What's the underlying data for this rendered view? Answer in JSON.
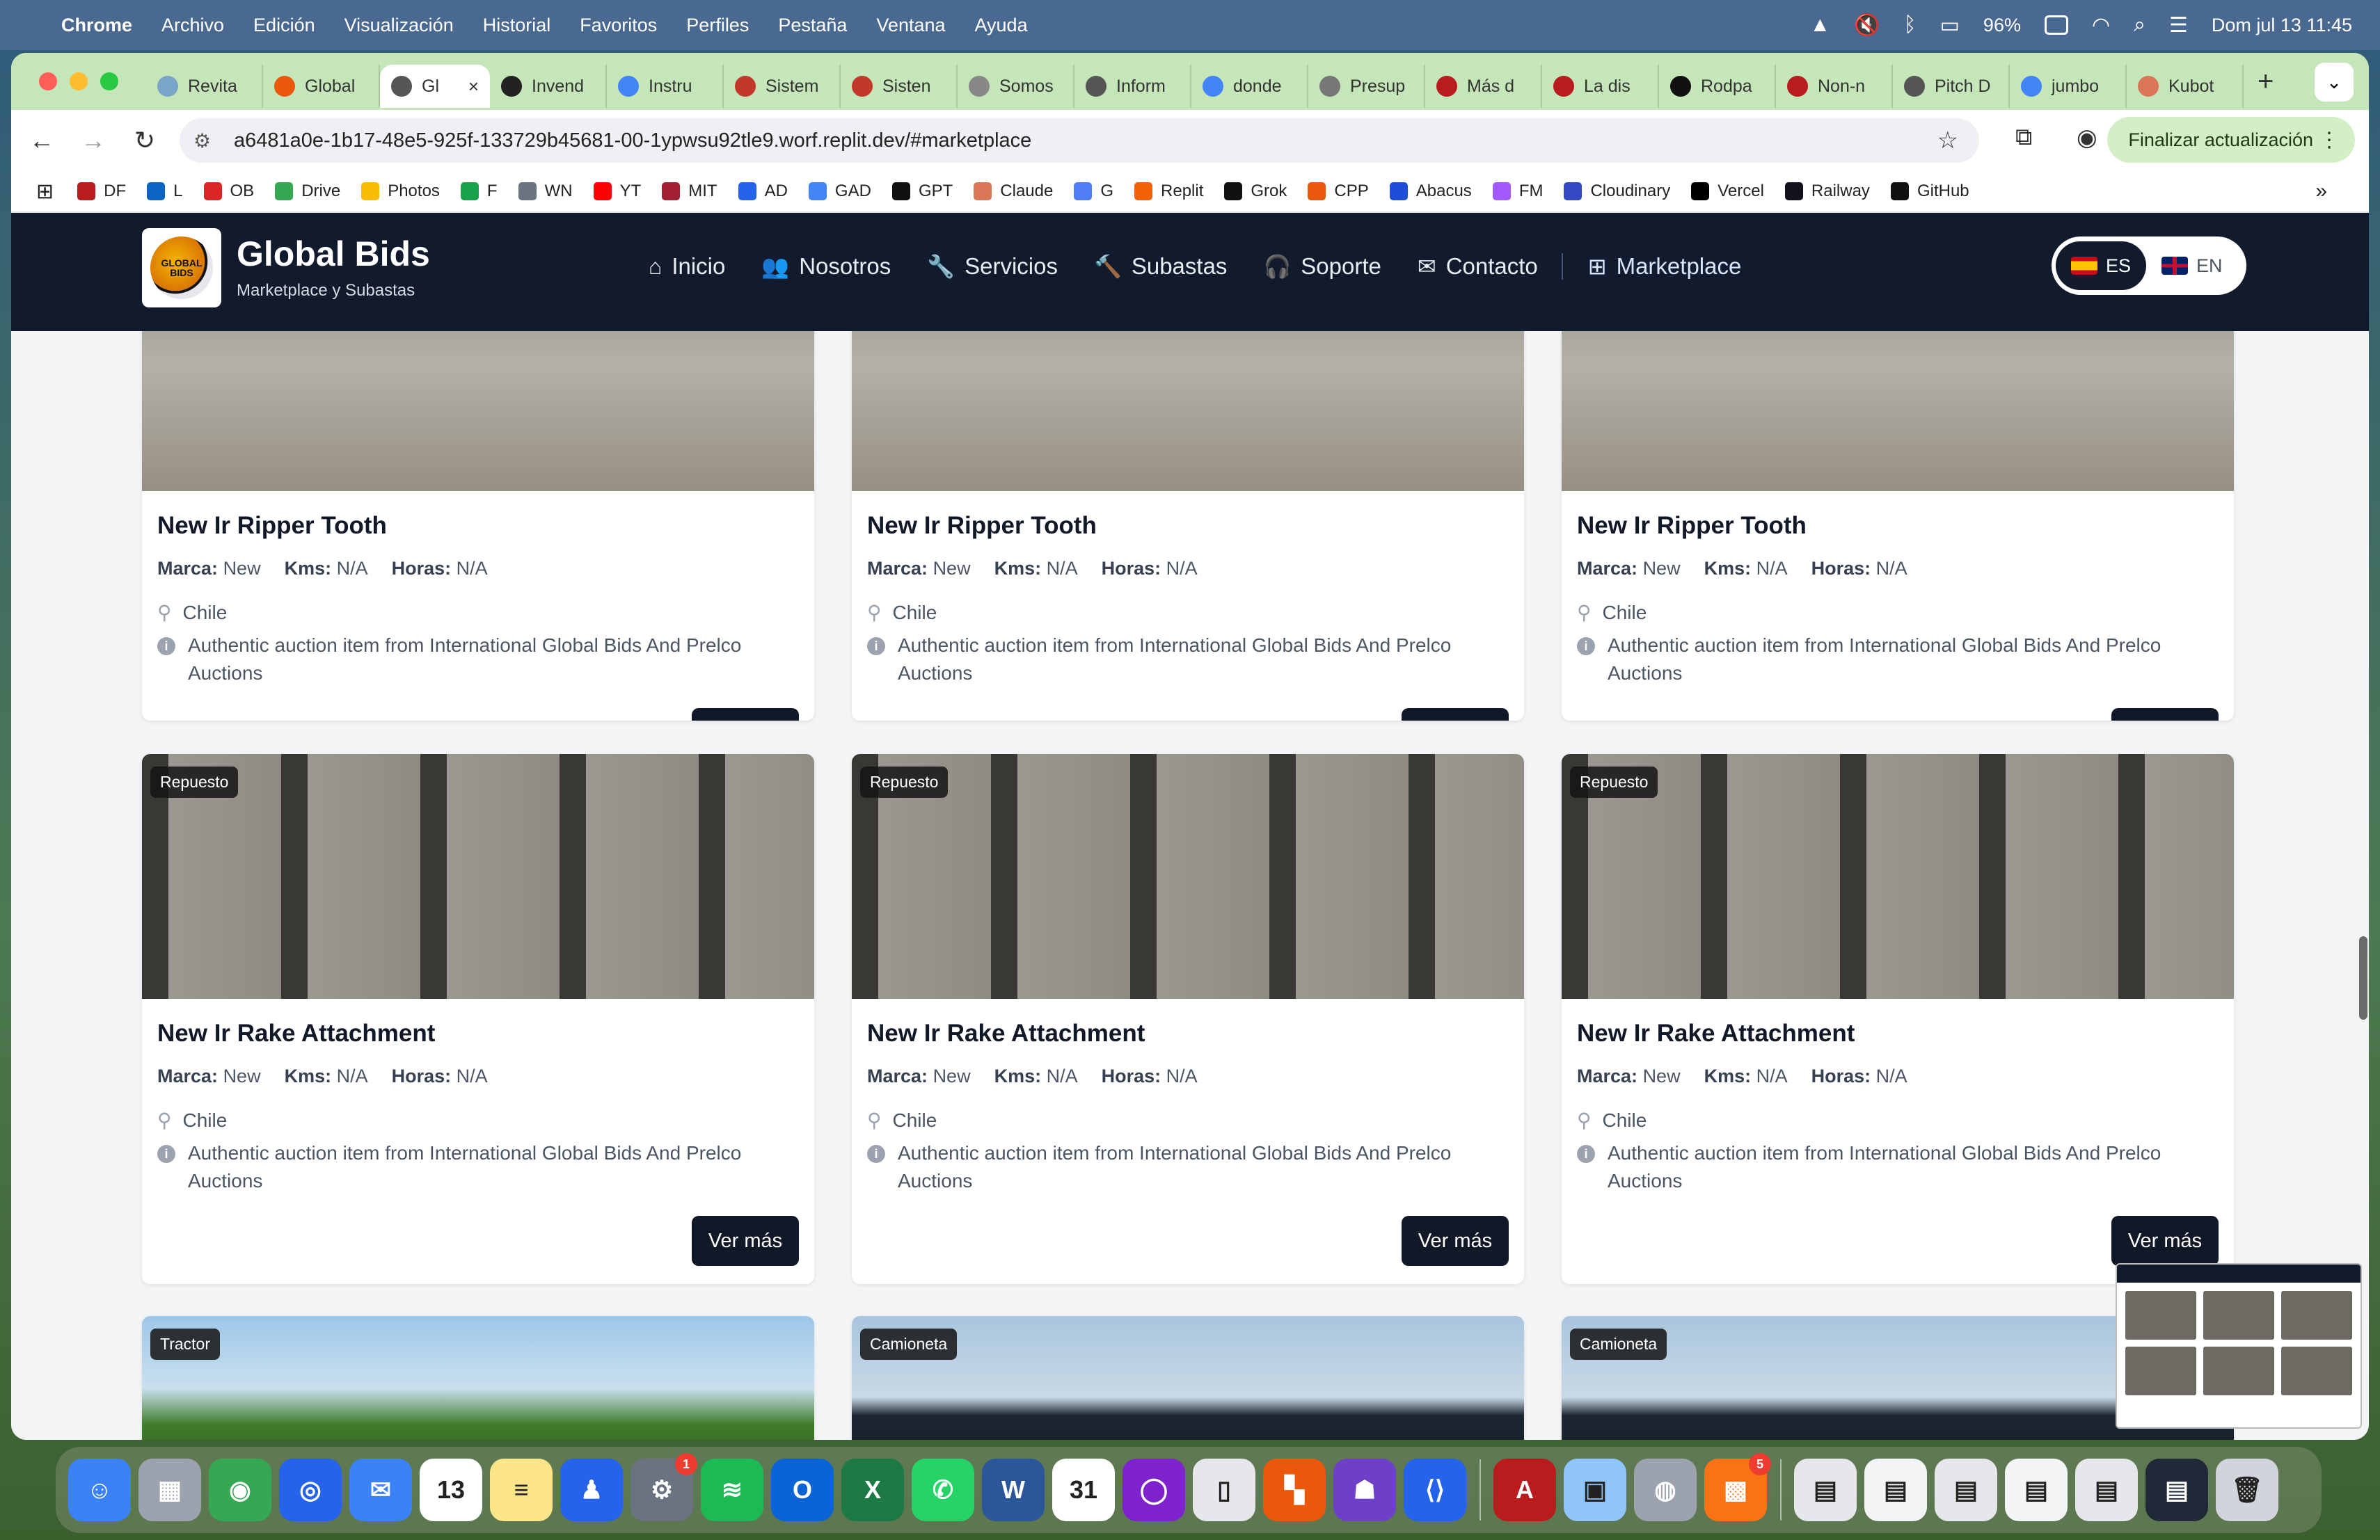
{
  "menubar": {
    "app": "Chrome",
    "items": [
      "Archivo",
      "Edición",
      "Visualización",
      "Historial",
      "Favoritos",
      "Perfiles",
      "Pestaña",
      "Ventana",
      "Ayuda"
    ],
    "battery": "96%",
    "datetime": "Dom jul 13  11:45"
  },
  "tabs": [
    {
      "label": "Revita",
      "color": "#7aa5c9"
    },
    {
      "label": "Global",
      "color": "#ea580c"
    },
    {
      "label": "Gl",
      "color": "#555555",
      "active": true
    },
    {
      "label": "Invend",
      "color": "#222222"
    },
    {
      "label": "Instru",
      "color": "#4285f4"
    },
    {
      "label": "Sistem",
      "color": "#c0392b"
    },
    {
      "label": "Sisten",
      "color": "#c0392b"
    },
    {
      "label": "Somos",
      "color": "#888888"
    },
    {
      "label": "Inform",
      "color": "#555555"
    },
    {
      "label": "donde",
      "color": "#4285f4"
    },
    {
      "label": "Presup",
      "color": "#777777"
    },
    {
      "label": "Más d",
      "color": "#b91c1c"
    },
    {
      "label": "La dis",
      "color": "#b91c1c"
    },
    {
      "label": "Rodpa",
      "color": "#111111"
    },
    {
      "label": "Non-n",
      "color": "#b91c1c"
    },
    {
      "label": "Pitch D",
      "color": "#555555"
    },
    {
      "label": "jumbo",
      "color": "#4285f4"
    },
    {
      "label": "Kubot",
      "color": "#d97757"
    }
  ],
  "address": {
    "url": "a6481a0e-1b17-48e5-925f-133729b45681-00-1ypwsu92tle9.worf.replit.dev/#marketplace",
    "update_label": "Finalizar actualización"
  },
  "bookmarks": [
    {
      "label": "DF",
      "color": "#b91c1c"
    },
    {
      "label": "L",
      "color": "#0a66c2"
    },
    {
      "label": "OB",
      "color": "#dc2626"
    },
    {
      "label": "Drive",
      "color": "#34a853"
    },
    {
      "label": "Photos",
      "color": "#fbbc04"
    },
    {
      "label": "F",
      "color": "#16a34a"
    },
    {
      "label": "WN",
      "color": "#6b7280"
    },
    {
      "label": "YT",
      "color": "#ff0000"
    },
    {
      "label": "MIT",
      "color": "#a31f34"
    },
    {
      "label": "AD",
      "color": "#2563eb"
    },
    {
      "label": "GAD",
      "color": "#4285f4"
    },
    {
      "label": "GPT",
      "color": "#111111"
    },
    {
      "label": "Claude",
      "color": "#d97757"
    },
    {
      "label": "G",
      "color": "#4f7df3"
    },
    {
      "label": "Replit",
      "color": "#f26207"
    },
    {
      "label": "Grok",
      "color": "#111111"
    },
    {
      "label": "CPP",
      "color": "#ea580c"
    },
    {
      "label": "Abacus",
      "color": "#1d4ed8"
    },
    {
      "label": "FM",
      "color": "#a259ff"
    },
    {
      "label": "Cloudinary",
      "color": "#3448c5"
    },
    {
      "label": "Vercel",
      "color": "#000000"
    },
    {
      "label": "Railway",
      "color": "#13111c"
    },
    {
      "label": "GitHub",
      "color": "#111111"
    }
  ],
  "site": {
    "brand_title": "Global Bids",
    "brand_sub": "Marketplace y Subastas",
    "logo_text": "GLOBAL BIDS",
    "nav": [
      {
        "label": "Inicio",
        "icon": "home-icon",
        "glyph": "⌂"
      },
      {
        "label": "Nosotros",
        "icon": "users-icon",
        "glyph": "👥"
      },
      {
        "label": "Servicios",
        "icon": "wrench-icon",
        "glyph": "🔧"
      },
      {
        "label": "Subastas",
        "icon": "gavel-icon",
        "glyph": "🔨"
      },
      {
        "label": "Soporte",
        "icon": "headset-icon",
        "glyph": "🎧"
      },
      {
        "label": "Contacto",
        "icon": "envelope-icon",
        "glyph": "✉"
      },
      {
        "label": "Marketplace",
        "icon": "grid-icon",
        "glyph": "⊞"
      }
    ],
    "lang_es": "ES",
    "lang_en": "EN"
  },
  "labels": {
    "marca": "Marca:",
    "kms": "Kms:",
    "horas": "Horas:",
    "ver_mas": "Ver más"
  },
  "cards_row1": [
    {
      "title": "New Ir Ripper Tooth",
      "marca": "New",
      "kms": "N/A",
      "horas": "N/A",
      "location": "Chile",
      "description": "Authentic auction item from International Global Bids And Prelco Auctions"
    },
    {
      "title": "New Ir Ripper Tooth",
      "marca": "New",
      "kms": "N/A",
      "horas": "N/A",
      "location": "Chile",
      "description": "Authentic auction item from International Global Bids And Prelco Auctions"
    },
    {
      "title": "New Ir Ripper Tooth",
      "marca": "New",
      "kms": "N/A",
      "horas": "N/A",
      "location": "Chile",
      "description": "Authentic auction item from International Global Bids And Prelco Auctions"
    }
  ],
  "cards_row2": [
    {
      "category": "Repuesto",
      "title": "New Ir Rake Attachment",
      "marca": "New",
      "kms": "N/A",
      "horas": "N/A",
      "location": "Chile",
      "description": "Authentic auction item from International Global Bids And Prelco Auctions"
    },
    {
      "category": "Repuesto",
      "title": "New Ir Rake Attachment",
      "marca": "New",
      "kms": "N/A",
      "horas": "N/A",
      "location": "Chile",
      "description": "Authentic auction item from International Global Bids And Prelco Auctions"
    },
    {
      "category": "Repuesto",
      "title": "New Ir Rake Attachment",
      "marca": "New",
      "kms": "N/A",
      "horas": "N/A",
      "location": "Chile",
      "description": "Authentic auction item from International Global Bids And Prelco Auctions"
    }
  ],
  "cards_row3": [
    {
      "category": "Tractor"
    },
    {
      "category": "Camioneta"
    },
    {
      "category": "Camioneta"
    }
  ],
  "dock": [
    {
      "name": "finder-icon",
      "color": "#3b82f6",
      "glyph": "☺"
    },
    {
      "name": "launchpad-icon",
      "color": "#9ca3af",
      "glyph": "▦"
    },
    {
      "name": "chrome-icon",
      "color": "#34a853",
      "glyph": "◉"
    },
    {
      "name": "safari-icon",
      "color": "#2563eb",
      "glyph": "◎"
    },
    {
      "name": "mail-icon",
      "color": "#3b82f6",
      "glyph": "✉"
    },
    {
      "name": "calendar-icon",
      "color": "#ffffff",
      "glyph": "13"
    },
    {
      "name": "notes-icon",
      "color": "#fde68a",
      "glyph": "≡"
    },
    {
      "name": "keynote-icon",
      "color": "#2563eb",
      "glyph": "♟"
    },
    {
      "name": "system-settings-icon",
      "color": "#6b7280",
      "glyph": "⚙",
      "badge": "1"
    },
    {
      "name": "spotify-icon",
      "color": "#1db954",
      "glyph": "≋"
    },
    {
      "name": "outlook-icon",
      "color": "#0a64d6",
      "glyph": "O"
    },
    {
      "name": "excel-icon",
      "color": "#1d7a45",
      "glyph": "X"
    },
    {
      "name": "whatsapp-icon",
      "color": "#25d366",
      "glyph": "✆"
    },
    {
      "name": "word-icon",
      "color": "#2b579a",
      "glyph": "W"
    },
    {
      "name": "fantastical-icon",
      "color": "#ffffff",
      "glyph": "31"
    },
    {
      "name": "circle-app-icon",
      "color": "#7e22ce",
      "glyph": "◯"
    },
    {
      "name": "iphone-mirroring-icon",
      "color": "#e5e7eb",
      "glyph": "▯"
    },
    {
      "name": "grid-app-icon",
      "color": "#ea580c",
      "glyph": "▚"
    },
    {
      "name": "github-desktop-icon",
      "color": "#6e40c9",
      "glyph": "☗"
    },
    {
      "name": "vscode-icon",
      "color": "#2563eb",
      "glyph": "⟨⟩"
    },
    {
      "name": "acrobat-icon",
      "color": "#b91c1c",
      "glyph": "A"
    },
    {
      "name": "preview-icon",
      "color": "#93c5fd",
      "glyph": "▣"
    },
    {
      "name": "disk-utility-icon",
      "color": "#9ca3af",
      "glyph": "◍"
    },
    {
      "name": "office-icon",
      "color": "#f97316",
      "glyph": "▩",
      "badge": "5"
    },
    {
      "name": "doc-thumb-1-icon",
      "color": "#e5e7eb",
      "glyph": "▤"
    },
    {
      "name": "doc-thumb-2-icon",
      "color": "#f3f4f6",
      "glyph": "▤"
    },
    {
      "name": "doc-thumb-3-icon",
      "color": "#e5e7eb",
      "glyph": "▤"
    },
    {
      "name": "doc-thumb-4-icon",
      "color": "#f3f4f6",
      "glyph": "▤"
    },
    {
      "name": "doc-thumb-5-icon",
      "color": "#e5e7eb",
      "glyph": "▤"
    },
    {
      "name": "doc-thumb-6-icon",
      "color": "#1f2937",
      "glyph": "▤"
    },
    {
      "name": "trash-icon",
      "color": "#d1d5db",
      "glyph": "🗑"
    }
  ]
}
